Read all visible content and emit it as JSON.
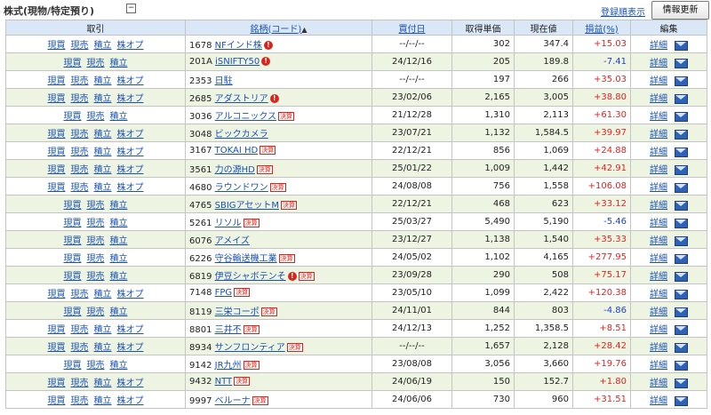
{
  "header": {
    "title": "株式(現物/特定預り)",
    "collapse_symbol": "−",
    "register_order_link": "登録順表示",
    "refresh_button": "情報更新"
  },
  "columns": {
    "trade": "取引",
    "code": "銘柄(コード)",
    "sort_arrow": "▲",
    "buy_date": "買付日",
    "cost": "取得単価",
    "price": "現在値",
    "pl": "損益(%)",
    "edit": "編集"
  },
  "action_labels": {
    "buy": "現買",
    "sell": "現売",
    "accumulate": "積立",
    "option": "株オプ"
  },
  "detail_label": "詳細",
  "rows": [
    {
      "code": "1678",
      "name": "NFインド株",
      "alert": true,
      "kessan": false,
      "date": "--/--/--",
      "cost": "302",
      "price": "347.4",
      "pl": "+15.03",
      "sign": "pos",
      "option": true
    },
    {
      "code": "201A",
      "name": "iSNIFTY50",
      "alert": true,
      "kessan": false,
      "date": "24/12/16",
      "cost": "205",
      "price": "189.8",
      "pl": "-7.41",
      "sign": "neg",
      "option": false
    },
    {
      "code": "2353",
      "name": "日駐",
      "alert": false,
      "kessan": false,
      "date": "--/--/--",
      "cost": "197",
      "price": "266",
      "pl": "+35.03",
      "sign": "pos",
      "option": true
    },
    {
      "code": "2685",
      "name": "アダストリア",
      "alert": true,
      "kessan": false,
      "date": "23/02/06",
      "cost": "2,165",
      "price": "3,005",
      "pl": "+38.80",
      "sign": "pos",
      "option": true
    },
    {
      "code": "3036",
      "name": "アルコニックス",
      "alert": false,
      "kessan": true,
      "date": "21/12/28",
      "cost": "1,310",
      "price": "2,113",
      "pl": "+61.30",
      "sign": "pos",
      "option": false
    },
    {
      "code": "3048",
      "name": "ビックカメラ",
      "alert": false,
      "kessan": false,
      "date": "23/07/21",
      "cost": "1,132",
      "price": "1,584.5",
      "pl": "+39.97",
      "sign": "pos",
      "option": true
    },
    {
      "code": "3167",
      "name": "TOKAI HD",
      "alert": false,
      "kessan": true,
      "date": "22/12/21",
      "cost": "856",
      "price": "1,069",
      "pl": "+24.88",
      "sign": "pos",
      "option": true
    },
    {
      "code": "3561",
      "name": "力の源HD",
      "alert": false,
      "kessan": true,
      "date": "25/01/22",
      "cost": "1,009",
      "price": "1,442",
      "pl": "+42.91",
      "sign": "pos",
      "option": true
    },
    {
      "code": "4680",
      "name": "ラウンドワン",
      "alert": false,
      "kessan": true,
      "date": "24/08/08",
      "cost": "756",
      "price": "1,558",
      "pl": "+106.08",
      "sign": "pos",
      "option": true
    },
    {
      "code": "4765",
      "name": "SBIGアセットM",
      "alert": false,
      "kessan": true,
      "date": "22/12/21",
      "cost": "468",
      "price": "623",
      "pl": "+33.12",
      "sign": "pos",
      "option": false
    },
    {
      "code": "5261",
      "name": "リソル",
      "alert": false,
      "kessan": true,
      "date": "25/03/27",
      "cost": "5,490",
      "price": "5,190",
      "pl": "-5.46",
      "sign": "neg",
      "option": false
    },
    {
      "code": "6076",
      "name": "アメイズ",
      "alert": false,
      "kessan": false,
      "date": "23/12/27",
      "cost": "1,138",
      "price": "1,540",
      "pl": "+35.33",
      "sign": "pos",
      "option": false
    },
    {
      "code": "6226",
      "name": "守谷輸送機工業",
      "alert": false,
      "kessan": true,
      "date": "24/05/02",
      "cost": "1,102",
      "price": "4,165",
      "pl": "+277.95",
      "sign": "pos",
      "option": false
    },
    {
      "code": "6819",
      "name": "伊豆シャボテンそ",
      "alert": true,
      "kessan": true,
      "date": "23/09/28",
      "cost": "290",
      "price": "508",
      "pl": "+75.17",
      "sign": "pos",
      "option": false
    },
    {
      "code": "7148",
      "name": "FPG",
      "alert": false,
      "kessan": true,
      "date": "23/05/10",
      "cost": "1,099",
      "price": "2,422",
      "pl": "+120.38",
      "sign": "pos",
      "option": true
    },
    {
      "code": "8119",
      "name": "三栄コーポ",
      "alert": false,
      "kessan": true,
      "date": "24/11/01",
      "cost": "844",
      "price": "803",
      "pl": "-4.86",
      "sign": "neg",
      "option": false
    },
    {
      "code": "8801",
      "name": "三井不",
      "alert": false,
      "kessan": true,
      "date": "24/12/13",
      "cost": "1,252",
      "price": "1,358.5",
      "pl": "+8.51",
      "sign": "pos",
      "option": true
    },
    {
      "code": "8934",
      "name": "サンフロンティア",
      "alert": false,
      "kessan": true,
      "date": "--/--/--",
      "cost": "1,657",
      "price": "2,128",
      "pl": "+28.42",
      "sign": "pos",
      "option": true
    },
    {
      "code": "9142",
      "name": "JR九州",
      "alert": false,
      "kessan": true,
      "date": "23/08/08",
      "cost": "3,056",
      "price": "3,660",
      "pl": "+19.76",
      "sign": "pos",
      "option": false
    },
    {
      "code": "9432",
      "name": "NTT",
      "alert": false,
      "kessan": true,
      "date": "24/06/19",
      "cost": "150",
      "price": "152.7",
      "pl": "+1.80",
      "sign": "pos",
      "option": true
    },
    {
      "code": "9997",
      "name": "ベルーナ",
      "alert": false,
      "kessan": true,
      "date": "24/06/06",
      "cost": "730",
      "price": "960",
      "pl": "+31.51",
      "sign": "pos",
      "option": true
    }
  ],
  "alert_glyph": "!",
  "kessan_badge": "決算",
  "colors": {
    "positive": "#e52222",
    "negative": "#1f3fd6",
    "header_bg": "#d9e7f6",
    "stripe_bg": "#eef4e2",
    "link": "#1a52b5"
  }
}
